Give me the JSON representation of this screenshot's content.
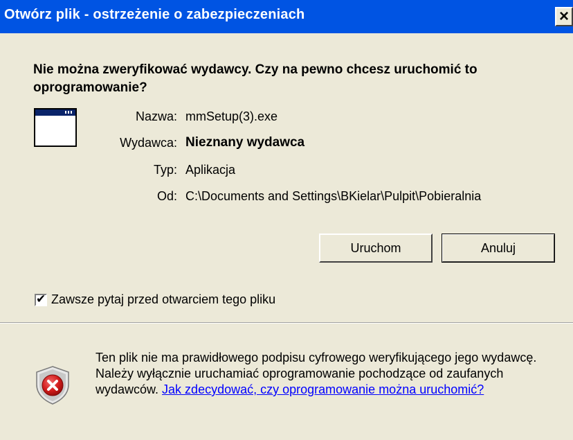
{
  "window": {
    "title": "Otwórz plik - ostrzeżenie o zabezpieczeniach",
    "close_glyph": "×"
  },
  "headline": "Nie można zweryfikować wydawcy. Czy na pewno chcesz uruchomić to oprogramowanie?",
  "file_icon": "application-window-icon",
  "fields": [
    {
      "label": "Nazwa:",
      "value": "mmSetup(3).exe"
    },
    {
      "label": "Wydawca:",
      "value": "Nieznany wydawca"
    },
    {
      "label": "Typ:",
      "value": "Aplikacja"
    },
    {
      "label": "Od:",
      "value": "C:\\Documents and Settings\\BKielar\\Pulpit\\Pobieralnia"
    }
  ],
  "buttons": {
    "run": "Uruchom",
    "cancel": "Anuluj"
  },
  "always_ask": {
    "checked": true,
    "glyph": "✔",
    "label": "Zawsze pytaj przed otwarciem tego pliku"
  },
  "warning": {
    "icon": "security-shield-icon",
    "text": "Ten plik nie ma prawidłowego podpisu cyfrowego weryfikującego jego wydawcę. Należy wyłącznie uruchamiać oprogramowanie pochodzące od zaufanych wydawców. ",
    "link": "Jak zdecydować, czy oprogramowanie można uruchomić?"
  },
  "colors": {
    "titlebar": "#0054E3",
    "dialog_bg": "#ECE9D8",
    "link": "#0000FF",
    "shield_red": "#D11A1A"
  }
}
